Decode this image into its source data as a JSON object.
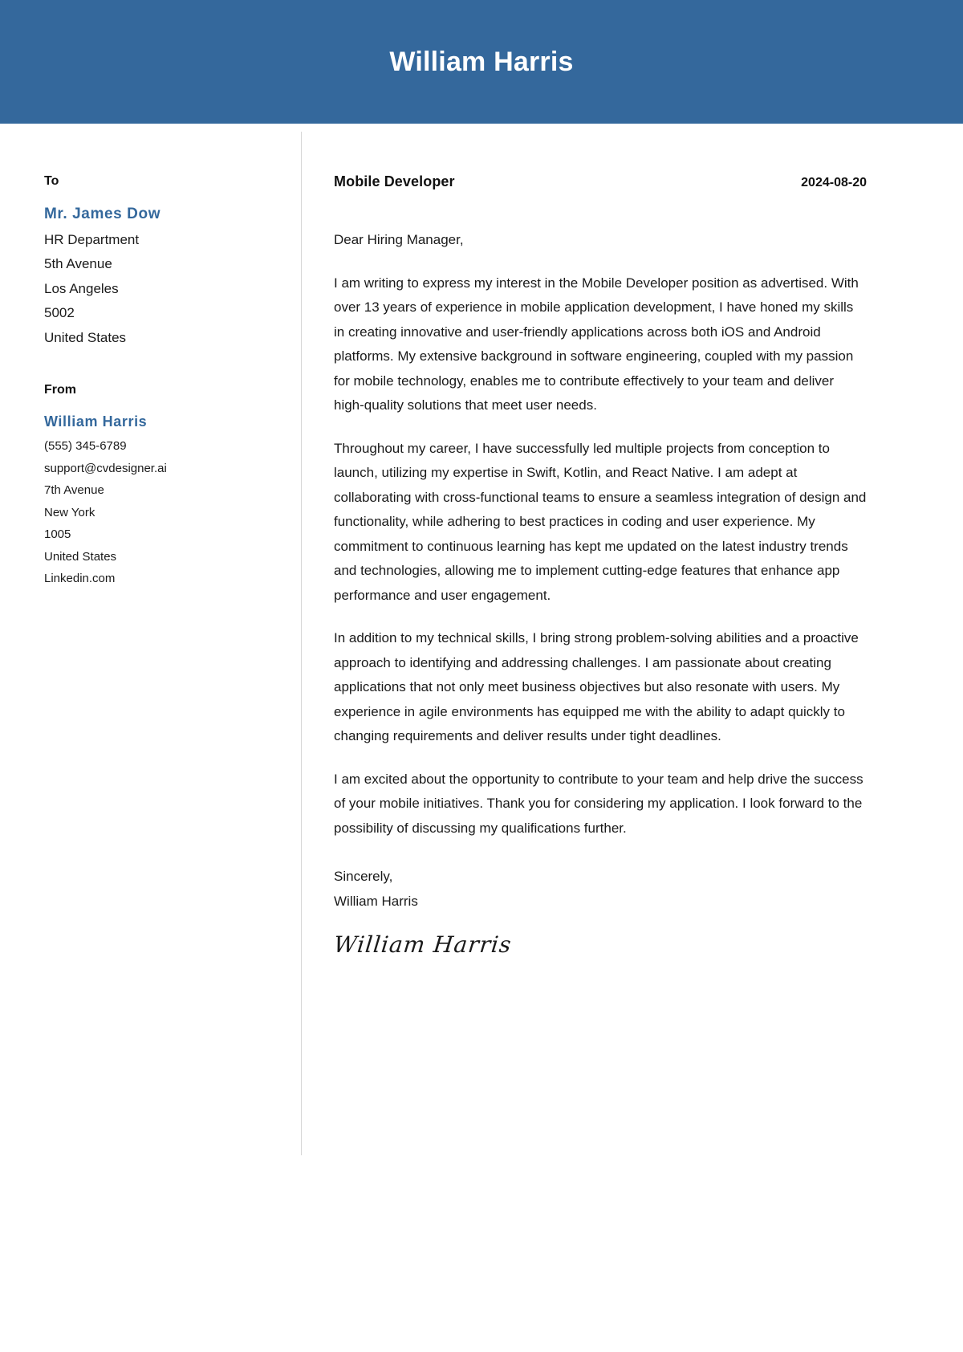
{
  "header": {
    "full_name": "William Harris",
    "accent_color": "#34689c",
    "text_color": "#ffffff"
  },
  "sidebar": {
    "to": {
      "label": "To",
      "name": "Mr. James Dow",
      "lines": [
        "HR Department",
        "5th Avenue",
        "Los Angeles",
        "5002",
        "United States"
      ]
    },
    "from": {
      "label": "From",
      "name": "William Harris",
      "lines": [
        "(555) 345-6789",
        "support@cvdesigner.ai",
        "7th Avenue",
        "New York",
        "1005",
        "United States",
        "Linkedin.com"
      ]
    }
  },
  "letter": {
    "job_title": "Mobile Developer",
    "date": "2024-08-20",
    "salutation": "Dear Hiring Manager,",
    "paragraphs": [
      "I am writing to express my interest in the Mobile Developer position as advertised. With over 13 years of experience in mobile application development, I have honed my skills in creating innovative and user-friendly applications across both iOS and Android platforms. My extensive background in software engineering, coupled with my passion for mobile technology, enables me to contribute effectively to your team and deliver high-quality solutions that meet user needs.",
      "Throughout my career, I have successfully led multiple projects from conception to launch, utilizing my expertise in Swift, Kotlin, and React Native. I am adept at collaborating with cross-functional teams to ensure a seamless integration of design and functionality, while adhering to best practices in coding and user experience. My commitment to continuous learning has kept me updated on the latest industry trends and technologies, allowing me to implement cutting-edge features that enhance app performance and user engagement.",
      "In addition to my technical skills, I bring strong problem-solving abilities and a proactive approach to identifying and addressing challenges. I am passionate about creating applications that not only meet business objectives but also resonate with users. My experience in agile environments has equipped me with the ability to adapt quickly to changing requirements and deliver results under tight deadlines.",
      "I am excited about the opportunity to contribute to your team and help drive the success of your mobile initiatives. Thank you for considering my application. I look forward to the possibility of discussing my qualifications further."
    ],
    "closing_salutation": "Sincerely,",
    "closing_name": "William Harris",
    "signature": "William Harris"
  }
}
